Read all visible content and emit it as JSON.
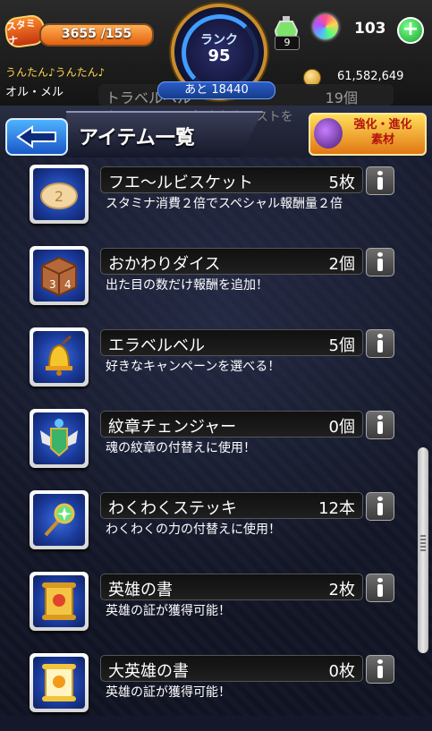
{
  "top": {
    "stamina_label": "スタミナ",
    "stamina_text": "3655 /155",
    "stamina_fill_fraction": 1.0,
    "rank_label": "ランク",
    "rank_value": "95",
    "next_text": "あと 18440",
    "potion_count": "9",
    "orb_count": "103",
    "player_title": "うんたん♪うんたん♪",
    "player_name": "オル・メル",
    "coins": "61,582,649"
  },
  "header": {
    "title": "アイテム一覧",
    "power_badge": "強化・進化\n素材",
    "hidden_row_name": "トラベルベル",
    "hidden_row_count": "19個",
    "hidden_row_desc": "タイムシフトで好きなクエストを"
  },
  "items": [
    {
      "name": "フエ～ルビスケット",
      "count": "5枚",
      "desc": "スタミナ消費２倍でスペシャル報酬量２倍",
      "icon": "biscuit-icon"
    },
    {
      "name": "おかわりダイス",
      "count": "2個",
      "desc": "出た目の数だけ報酬を追加！",
      "icon": "dice-icon"
    },
    {
      "name": "エラベルベル",
      "count": "5個",
      "desc": "好きなキャンペーンを選べる！",
      "icon": "bell-icon"
    },
    {
      "name": "紋章チェンジャー",
      "count": "0個",
      "desc": "魂の紋章の付替えに使用！",
      "icon": "emblem-icon"
    },
    {
      "name": "わくわくステッキ",
      "count": "12本",
      "desc": "わくわくの力の付替えに使用！",
      "icon": "wand-icon"
    },
    {
      "name": "英雄の書",
      "count": "2枚",
      "desc": "英雄の証が獲得可能！",
      "icon": "scroll-icon"
    },
    {
      "name": "大英雄の書",
      "count": "0枚",
      "desc": "英雄の証が獲得可能！",
      "icon": "grand-scroll-icon"
    }
  ]
}
